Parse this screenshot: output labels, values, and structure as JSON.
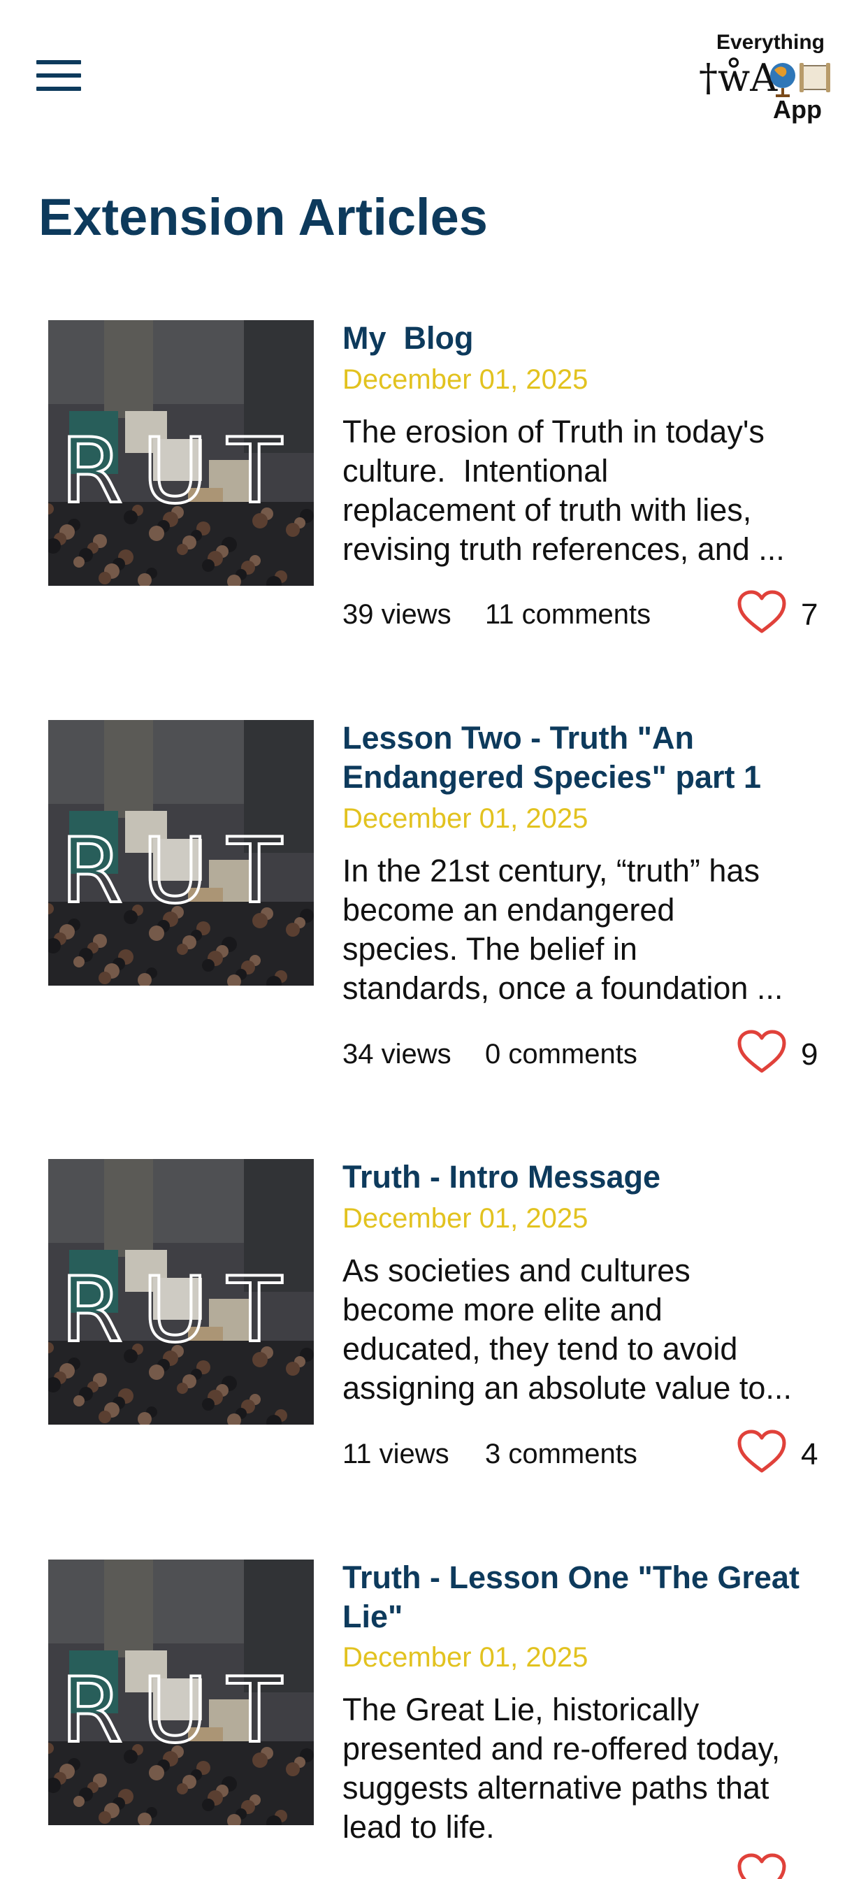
{
  "header": {
    "logo_line1": "Everything",
    "logo_line2": "App",
    "logo_glyphs": "†ẘA"
  },
  "page_title": "Extension Articles",
  "thumbnail": {
    "overlay_text": "RUT"
  },
  "icons": {
    "menu": "hamburger-icon",
    "like": "heart-icon"
  },
  "colors": {
    "title": "#0d3a5c",
    "date": "#e2c21f",
    "heart": "#e0413a"
  },
  "articles": [
    {
      "title_lines": [
        "My  Blog"
      ],
      "date": "December 01, 2025",
      "excerpt_lines": [
        "The erosion of Truth in today's",
        "culture.  Intentional",
        "replacement of truth with lies,",
        "revising truth references, and ..."
      ],
      "views": "39 views",
      "comments": "11 comments",
      "likes": "7"
    },
    {
      "title_lines": [
        "Lesson Two - Truth \"An",
        "Endangered Species\" part 1"
      ],
      "date": "December 01, 2025",
      "excerpt_lines": [
        "In the 21st century, “truth” has",
        "become an endangered",
        "species. The belief in",
        "standards, once a foundation ..."
      ],
      "views": "34 views",
      "comments": "0 comments",
      "likes": "9"
    },
    {
      "title_lines": [
        "Truth - Intro Message"
      ],
      "date": "December 01, 2025",
      "excerpt_lines": [
        "As societies and cultures",
        "become more elite and",
        "educated, they tend to avoid",
        "assigning an absolute value to..."
      ],
      "views": "11 views",
      "comments": "3 comments",
      "likes": "4"
    },
    {
      "title_lines": [
        "Truth - Lesson One \"The Great",
        "Lie\""
      ],
      "date": "December 01, 2025",
      "excerpt_lines": [
        "The Great Lie, historically",
        "presented and re-offered today,",
        "suggests alternative paths that",
        "lead to life."
      ]
    }
  ]
}
